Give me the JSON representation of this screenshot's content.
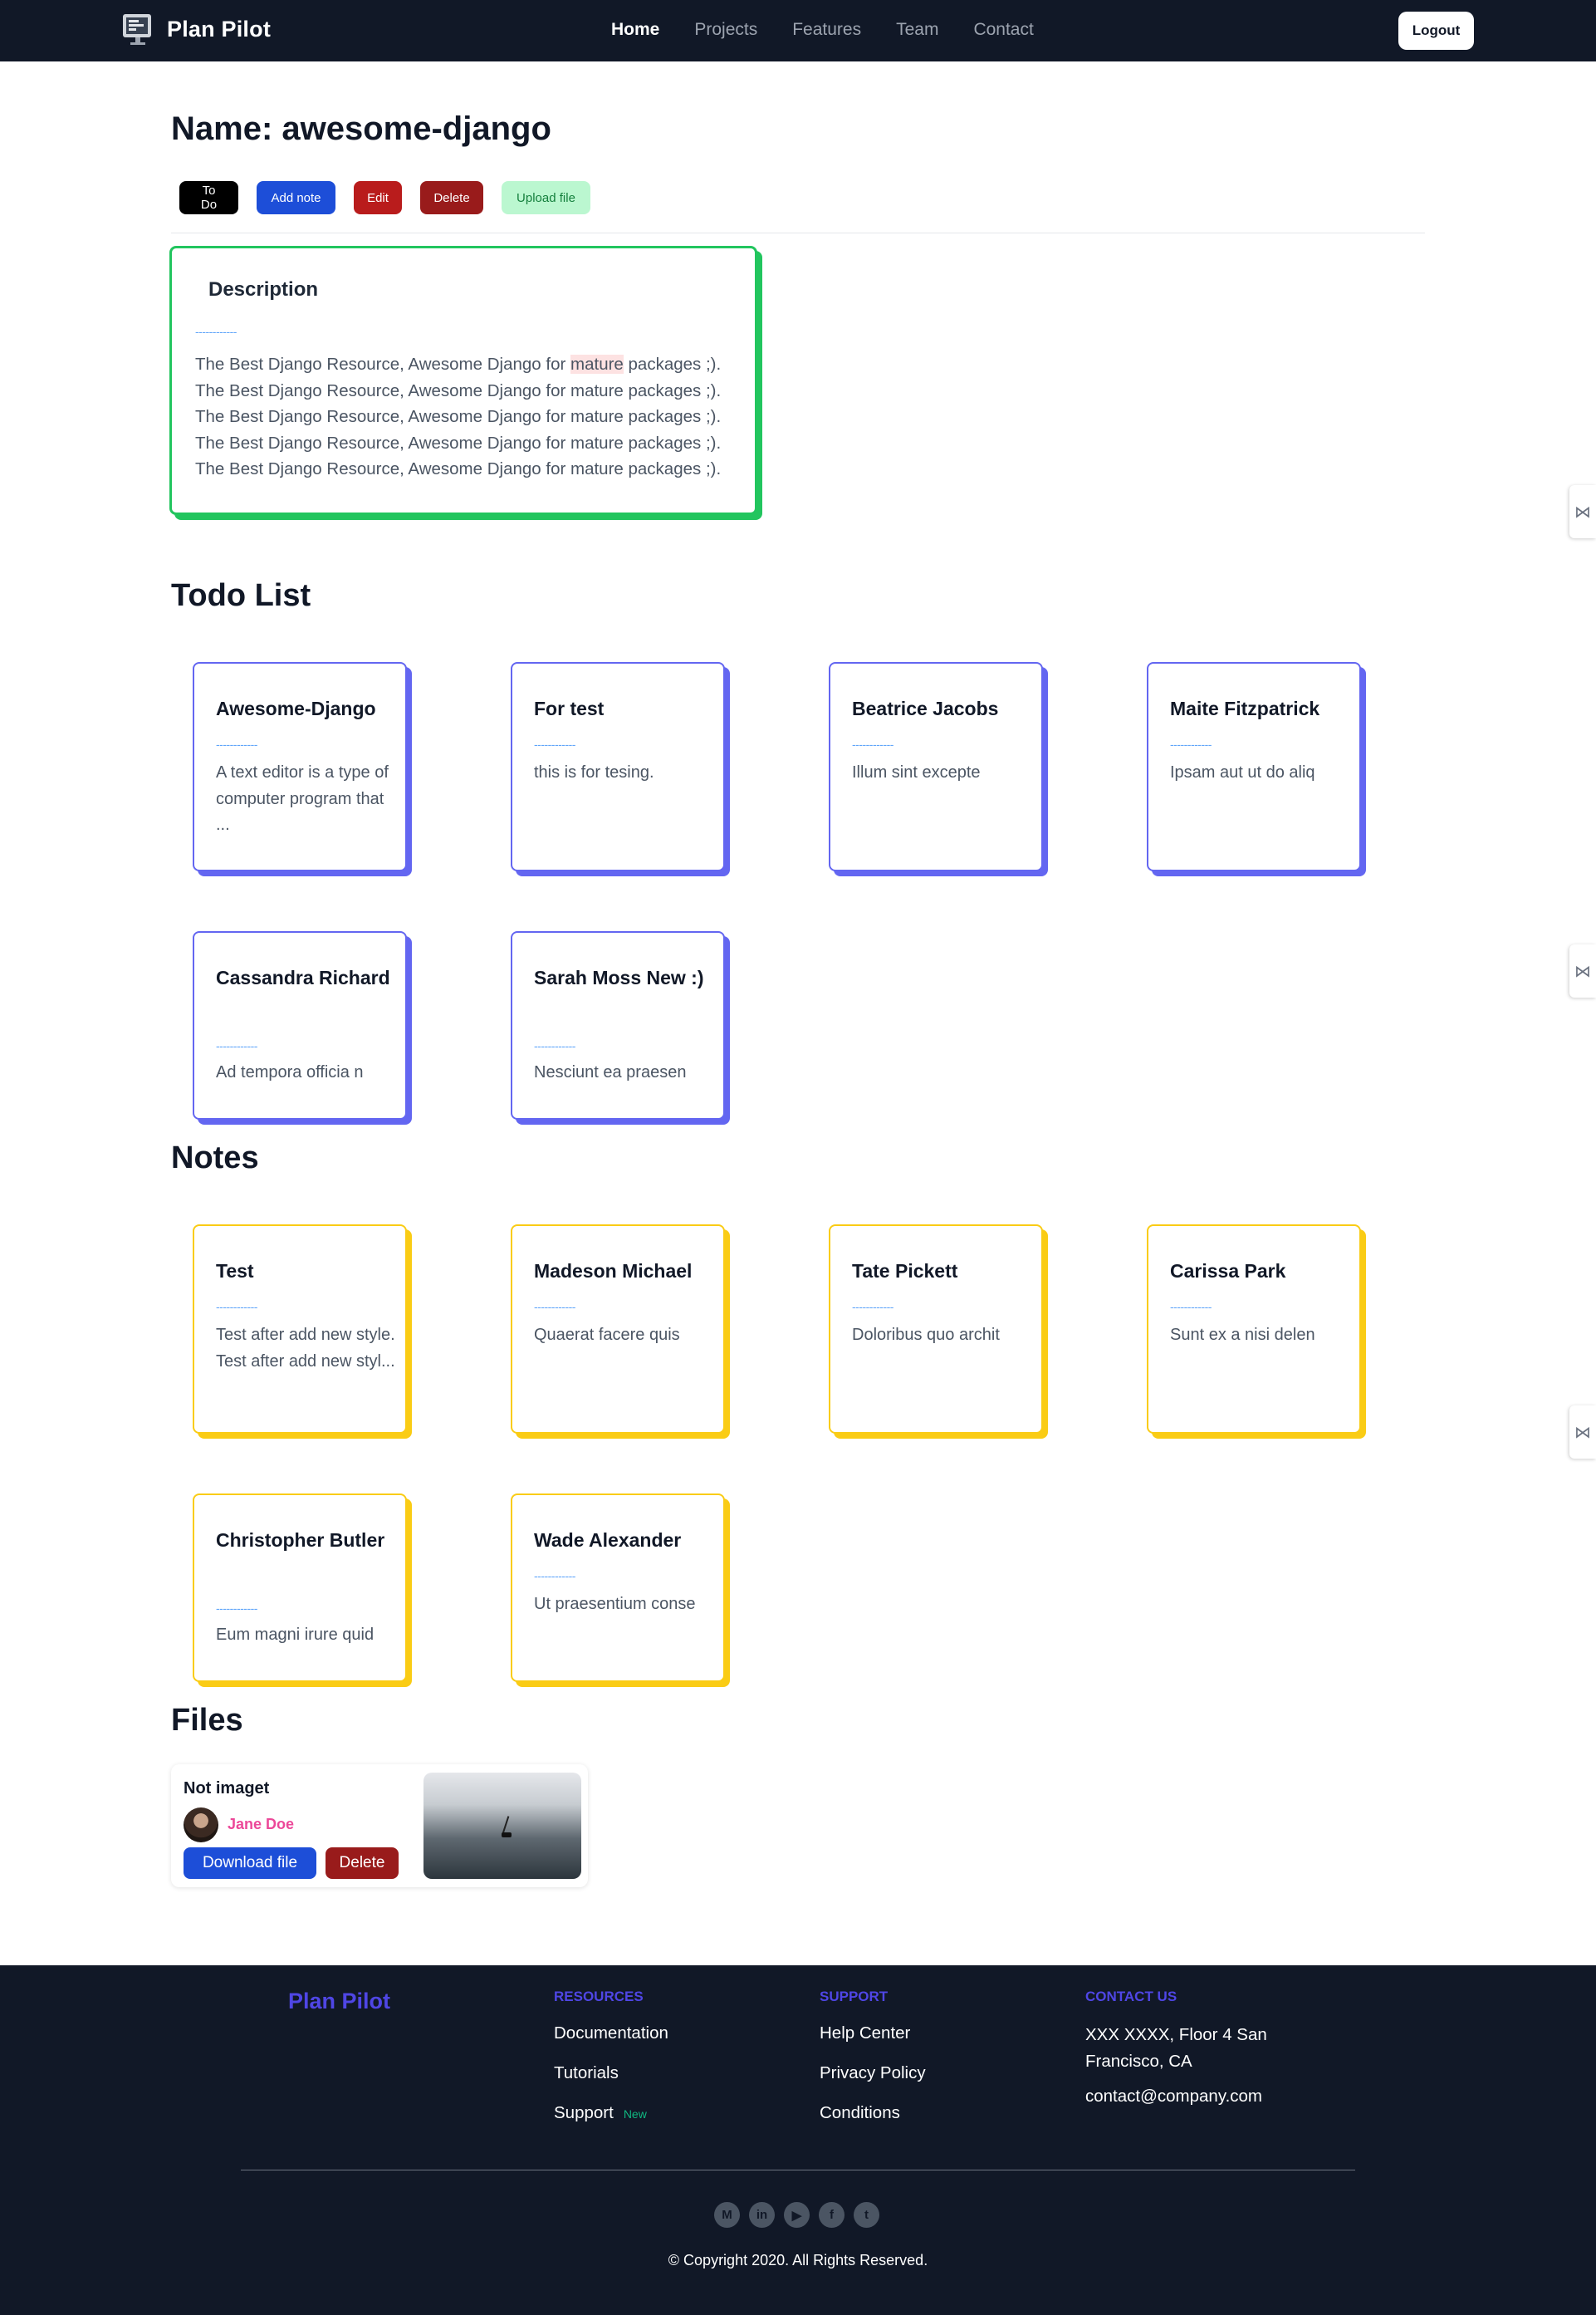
{
  "nav": {
    "brand": "Plan Pilot",
    "links": [
      "Home",
      "Projects",
      "Features",
      "Team",
      "Contact"
    ],
    "logout": "Logout"
  },
  "project": {
    "title": "Name: awesome-django",
    "actions": [
      "To Do",
      "Add note",
      "Edit",
      "Delete",
      "Upload file"
    ]
  },
  "description": {
    "title": "Description",
    "dash": "------------",
    "line_pre": "The Best Django Resource, Awesome Django for ",
    "line_hl": "mature",
    "line_post": " packages ;).",
    "lines": [
      "The Best Django Resource, Awesome Django for mature packages ;).",
      "The Best Django Resource, Awesome Django for mature packages ;).",
      "The Best Django Resource, Awesome Django for mature packages ;).",
      "The Best Django Resource, Awesome Django for mature packages ;)."
    ]
  },
  "todo": {
    "heading": "Todo List",
    "items": [
      {
        "title": "Awesome-Django",
        "text": "A text editor is a type of computer program that ..."
      },
      {
        "title": "For test",
        "text": "this is for tesing."
      },
      {
        "title": "Beatrice Jacobs",
        "text": "Illum sint excepte"
      },
      {
        "title": "Maite Fitzpatrick",
        "text": "Ipsam aut ut do aliq"
      },
      {
        "title": "Cassandra Richard",
        "text": "Ad tempora officia n"
      },
      {
        "title": "Sarah Moss New :)",
        "text": "Nesciunt ea praesen"
      }
    ]
  },
  "notes": {
    "heading": "Notes",
    "items": [
      {
        "title": "Test",
        "text": "Test after add new style. Test after add new styl..."
      },
      {
        "title": "Madeson Michael",
        "text": "Quaerat facere quis"
      },
      {
        "title": "Tate Pickett",
        "text": "Doloribus quo archit"
      },
      {
        "title": "Carissa Park",
        "text": "Sunt ex a nisi delen"
      },
      {
        "title": "Christopher Butler",
        "text": "Eum magni irure quid"
      },
      {
        "title": "Wade Alexander",
        "text": "Ut praesentium conse"
      }
    ]
  },
  "files": {
    "heading": "Files",
    "item": {
      "name": "Not imaget",
      "user": "Jane Doe",
      "download": "Download file",
      "delete": "Delete"
    }
  },
  "footer": {
    "brand": "Plan Pilot",
    "resources": {
      "heading": "RESOURCES",
      "links": [
        "Documentation",
        "Tutorials",
        "Support"
      ],
      "badge": "New"
    },
    "support": {
      "heading": "SUPPORT",
      "links": [
        "Help Center",
        "Privacy Policy",
        "Conditions"
      ]
    },
    "contact": {
      "heading": "CONTACT US",
      "address": "XXX XXXX, Floor 4 San Francisco, CA",
      "email": "contact@company.com"
    },
    "socials": [
      {
        "icon": "medium-icon",
        "glyph": "M"
      },
      {
        "icon": "linkedin-icon",
        "glyph": "in"
      },
      {
        "icon": "youtube-icon",
        "glyph": "▶"
      },
      {
        "icon": "facebook-icon",
        "glyph": "f"
      },
      {
        "icon": "twitter-icon",
        "glyph": "t"
      }
    ],
    "copyright": "© Copyright 2020. All Rights Reserved."
  },
  "colors": {
    "nav_bg": "#111827",
    "todo_accent": "#6366f1",
    "note_accent": "#facc15",
    "desc_accent": "#22c55e",
    "brand_accent": "#4f46e5"
  }
}
